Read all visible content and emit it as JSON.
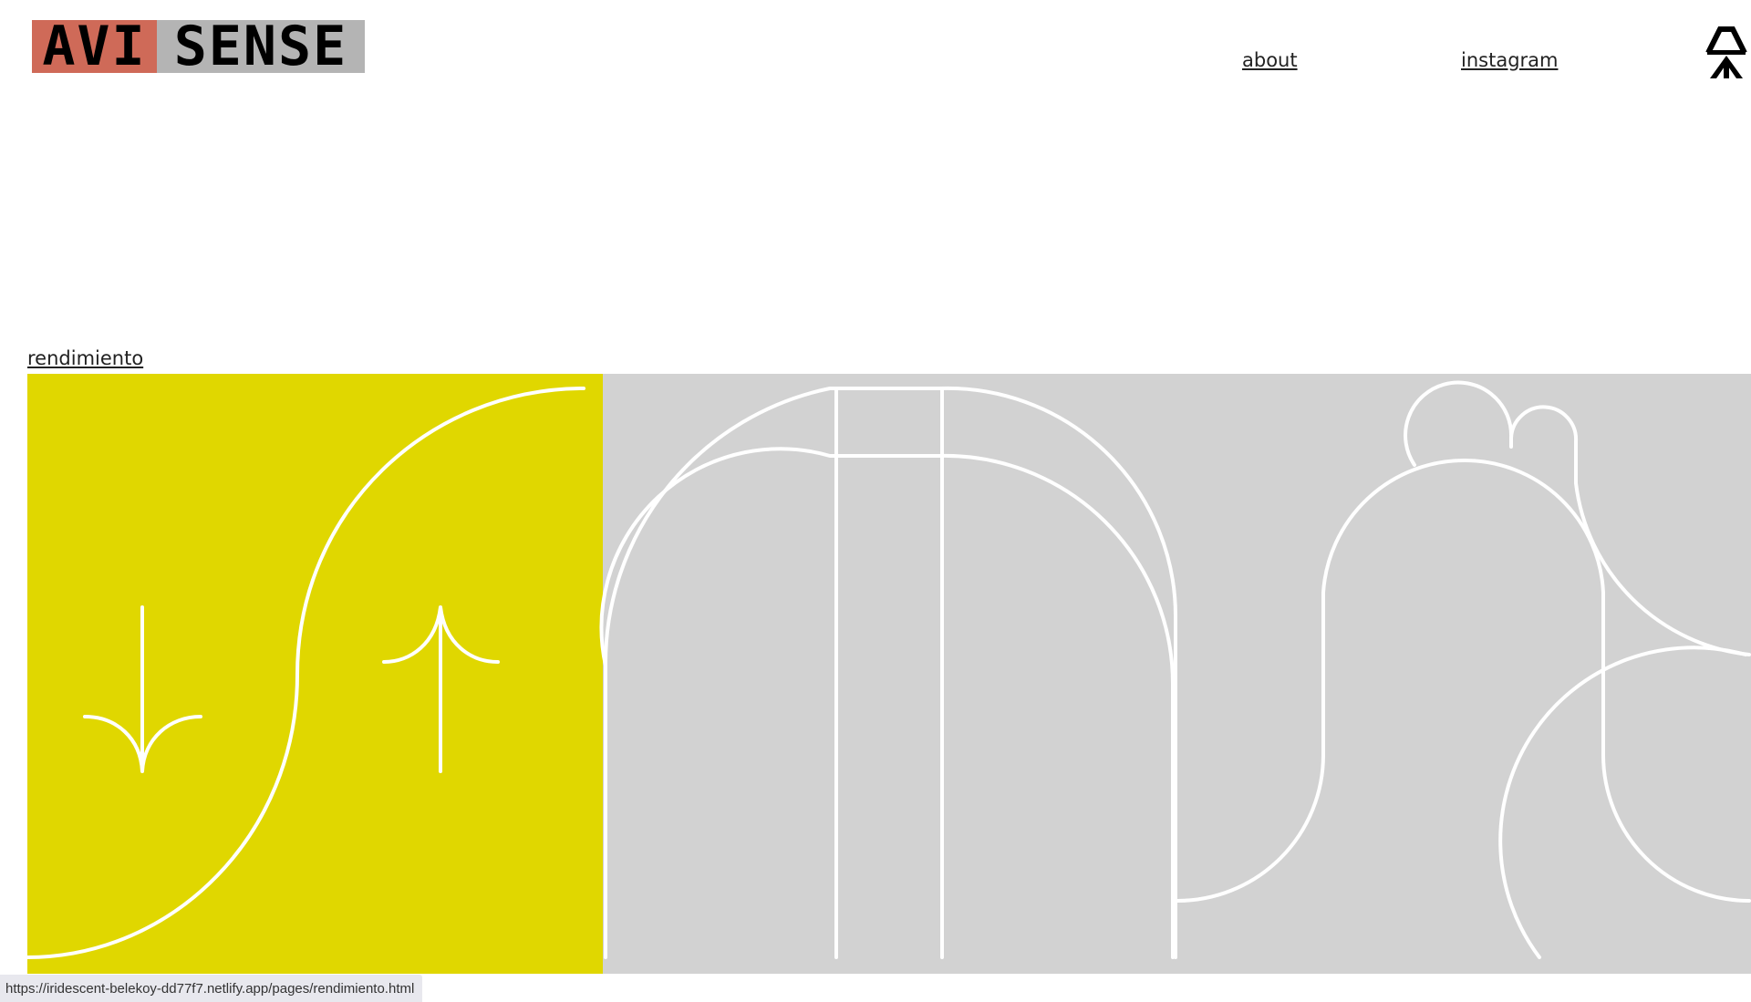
{
  "header": {
    "logo": {
      "part1": "AVI",
      "part2": "SENSE",
      "part1_color": "#cf6a58",
      "part2_color": "#b4b4b4"
    },
    "nav": {
      "about": "about",
      "instagram": "instagram"
    },
    "brand_mark_icon": "arrow-mark-icon"
  },
  "main": {
    "section_link": "rendimiento",
    "banner": {
      "yellow": "#e0d700",
      "gray": "#d2d2d2",
      "stroke": "#ffffff"
    }
  },
  "status_bar": {
    "url": "https://iridescent-belekoy-dd77f7.netlify.app/pages/rendimiento.html"
  }
}
